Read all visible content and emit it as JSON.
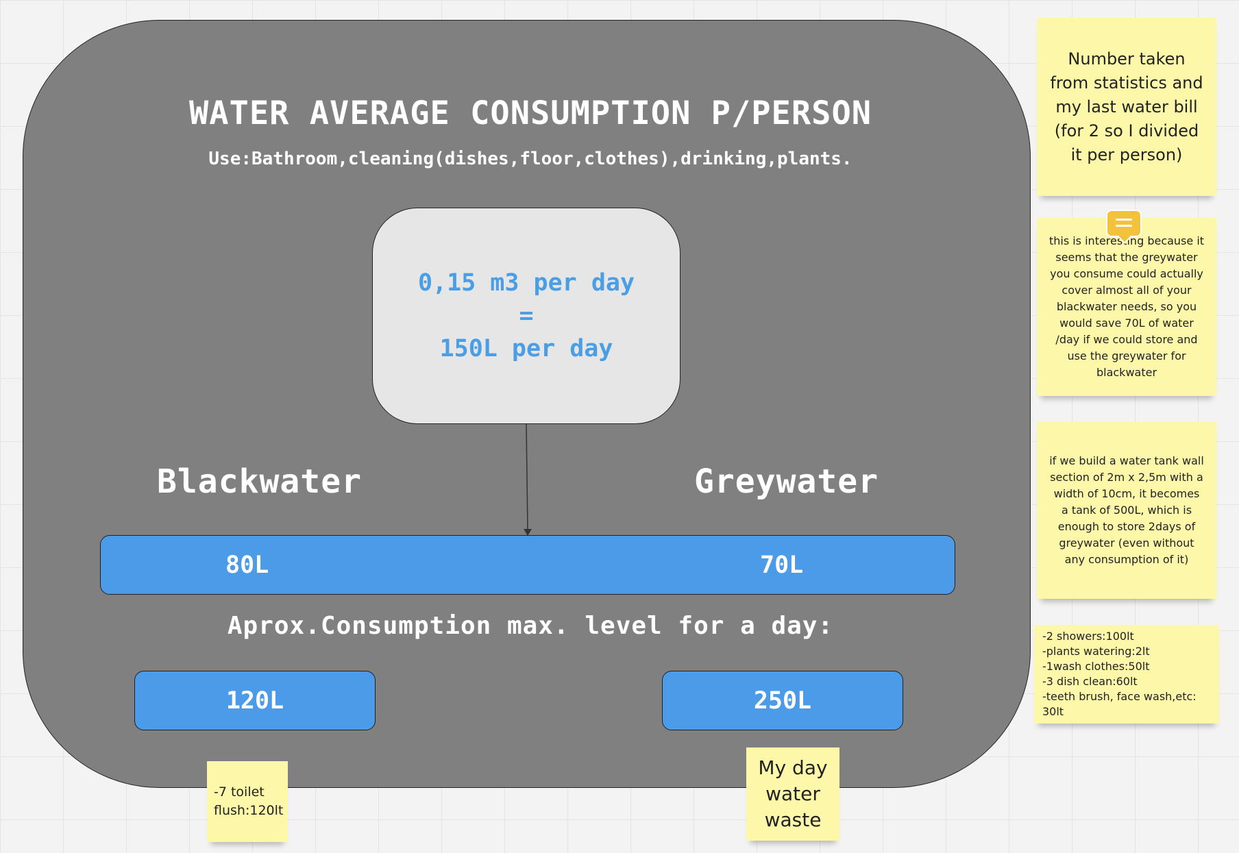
{
  "diagram": {
    "title": "WATER AVERAGE CONSUMPTION P/PERSON",
    "subtitle": "Use:Bathroom,cleaning(dishes,floor,clothes),drinking,plants.",
    "center_box": {
      "line1": "0,15 m3 per day",
      "line2": "=",
      "line3": "150L per day"
    },
    "blackwater_label": "Blackwater",
    "greywater_label": "Greywater",
    "split_bar": {
      "left_value": "80L",
      "right_value": "70L"
    },
    "max_level_label": "Aprox.Consumption max. level for a day:",
    "max_left": "120L",
    "max_right": "250L"
  },
  "stickies": {
    "note_source": "Number taken from statistics and my last water bill (for 2 so I divided it per person)",
    "note_interesting": "this is interesting because it seems that the greywater you consume could actually cover almost all of your blackwater needs, so you would save 70L of water /day if we could store and use the greywater for blackwater",
    "note_tank": "if we build a water tank wall section of 2m x 2,5m with a width of 10cm, it becomes a tank of 500L, which is enough to store 2days of greywater (even without any consumption of it)",
    "note_breakdown": "-2 showers:100lt\n-plants watering:2lt\n-1wash clothes:50lt\n-3 dish clean:60lt\n-teeth brush, face wash,etc: 30lt",
    "note_toilet": "-7 toilet flush:120lt",
    "note_day": "My day water waste"
  },
  "icons": {
    "comment": "comment-icon"
  },
  "colors": {
    "board": "#808080",
    "accent": "#4c9be8",
    "sticky": "#fdf7a9",
    "comment": "#f3c23c"
  }
}
